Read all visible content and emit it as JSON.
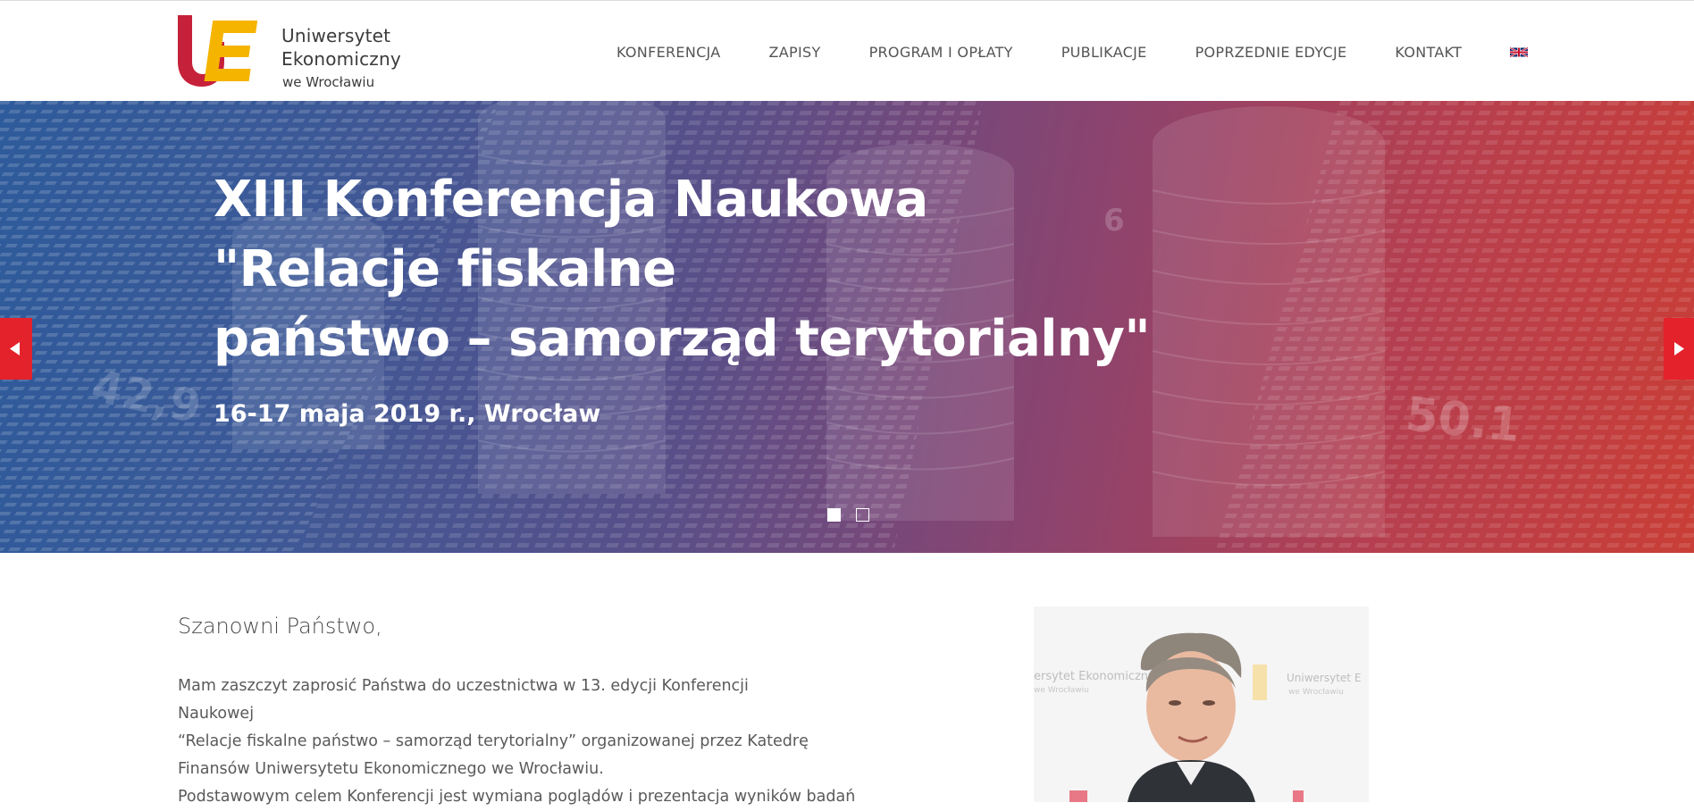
{
  "brand": {
    "logo_mark": "UE",
    "name_line1": "Uniwersytet Ekonomiczny",
    "name_line2": "we Wrocławiu",
    "colors": {
      "u": "#c6213a",
      "e": "#f5b400",
      "accent": "#e4222b"
    }
  },
  "nav": {
    "items": [
      {
        "label": "KONFERENCJA"
      },
      {
        "label": "ZAPISY"
      },
      {
        "label": "PROGRAM I OPŁATY"
      },
      {
        "label": "PUBLIKACJE"
      },
      {
        "label": "POPRZEDNIE EDYCJE"
      },
      {
        "label": "KONTAKT"
      }
    ],
    "language_icon": "uk-flag-icon"
  },
  "hero": {
    "title_lines": [
      "XIII Konferencja Naukowa",
      "\"Relacje fiskalne",
      "państwo – samorząd terytorialny\""
    ],
    "date": "16-17 maja 2019 r., Wrocław",
    "background_numbers": [
      "42,9",
      "6",
      "50.1"
    ],
    "prev_icon": "chevron-left-icon",
    "next_icon": "chevron-right-icon",
    "slides": 2,
    "active_slide": 1
  },
  "content": {
    "greeting": "Szanowni Państwo,",
    "paragraph1_lines": [
      "Mam zaszczyt zaprosić Państwa do uczestnictwa w 13. edycji Konferencji Naukowej",
      "“Relacje fiskalne państwo – samorząd terytorialny” organizowanej przez Katedrę",
      "Finansów Uniwersytetu Ekonomicznego we Wrocławiu."
    ],
    "paragraph2_start": "Podstawowym celem Konferencji jest wymiana poglądów i prezentacja wyników badań",
    "photo": {
      "backdrop_text_line1": "ersytet Ekonomiczny",
      "backdrop_text_line2": "we Wrocławiu",
      "backdrop_text_right1": "Uniwersytet E",
      "backdrop_text_right2": "we Wrocławiu"
    }
  }
}
